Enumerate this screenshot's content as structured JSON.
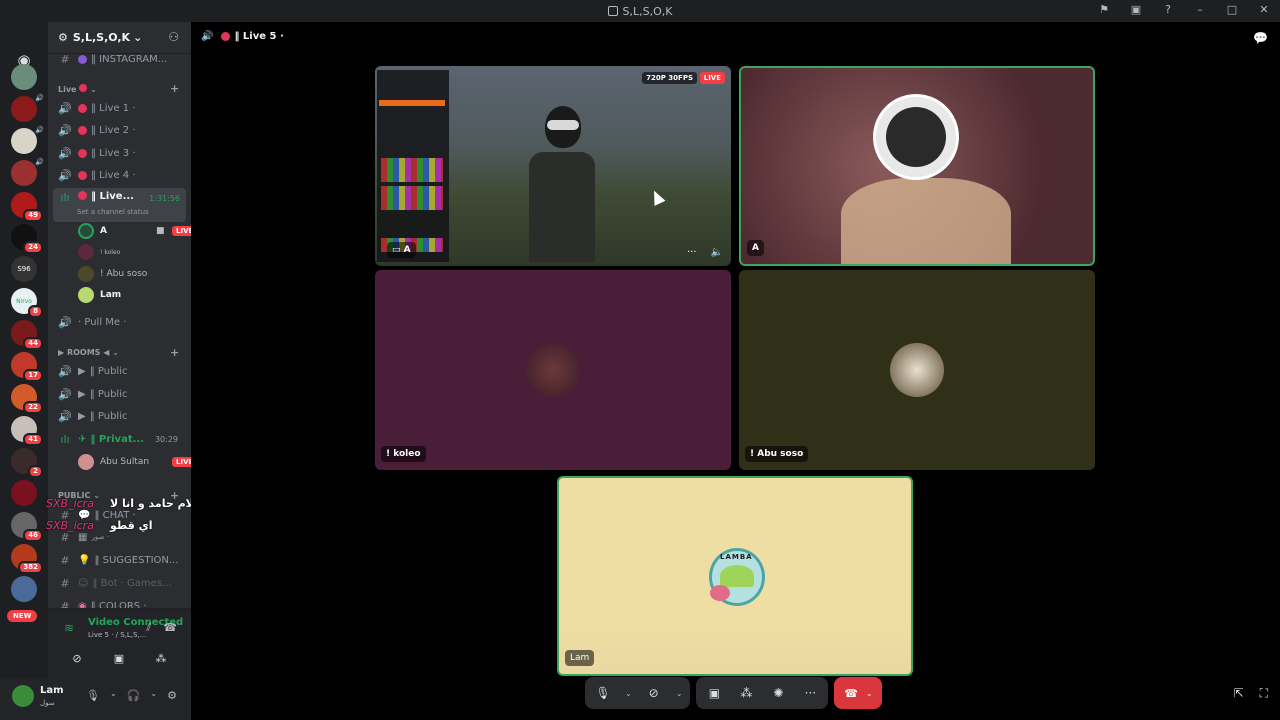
{
  "window": {
    "title": "S,L,S,O,K",
    "controls": [
      "flag-icon",
      "screen-icon",
      "help-icon",
      "minimize-icon",
      "maximize-icon",
      "close-icon"
    ]
  },
  "server_rail": {
    "badges": [
      "49",
      "24",
      "8",
      "44",
      "17",
      "22",
      "41",
      "2",
      "46",
      "382"
    ],
    "new_label": "NEW",
    "s96_label": "S96",
    "nirvo_label": "Nirvo"
  },
  "guild": {
    "name": "S,L,S,O,K",
    "chevron": "⌄"
  },
  "channels": {
    "instagram": "‖ INSTAGRAM...",
    "live_category": "Live",
    "live1": "‖ Live 1 ·",
    "live2": "‖ Live 2 ·",
    "live3": "‖ Live 3 ·",
    "live4": "‖ Live 4 ·",
    "live5": "‖ Live...",
    "live5_time": "1:31:56",
    "live5_status": "Set a channel status",
    "voice_users": [
      {
        "name": "A",
        "live": "LIVE"
      },
      {
        "name": "! koleo"
      },
      {
        "name": "! Abu soso"
      },
      {
        "name": "Lam"
      }
    ],
    "pull_me": "· Pull Me ·",
    "rooms_category": "ROOMS",
    "public1": "‖ Public",
    "public2": "‖ Public",
    "public3": "‖ Public",
    "private": "‖ Privat...",
    "private_time": "30:29",
    "abu_sultan": "Abu Sultan",
    "abu_sultan_live": "LIVE",
    "public_category": "PUBLIC",
    "chat": "‖ CHAT ·",
    "chat_sub": "صور ·",
    "suggestion": "‖ SUGGESTION...",
    "bot_games": "‖ Bot · Games...",
    "colors": "‖ COLORS ·"
  },
  "overlay": {
    "line1_ar": "يعني تقرا كلام حامد و انا لا",
    "line1_user": "SXB_icra",
    "line2_ar": "اي قطو",
    "line2_user": "SXB_icra"
  },
  "voice_panel": {
    "status": "Video Connected",
    "sub": "Live 5 · / S,L,S,..."
  },
  "user_panel": {
    "name": "Lam",
    "status": "سول"
  },
  "stage": {
    "channel": "‖ Live 5 ·",
    "tiles": {
      "game": {
        "resolution": "720P 30FPS",
        "live": "LIVE",
        "user_tag": "A"
      },
      "cam": {
        "user_tag": "A"
      },
      "koleo": {
        "name": "! koleo"
      },
      "abu": {
        "name": "! Abu soso"
      },
      "lam": {
        "name": "Lam",
        "logo_text": "LAMBA"
      }
    }
  },
  "colors": {
    "accent_green": "#23a55a",
    "live_red": "#f23f43",
    "hangup_red": "#da373c"
  }
}
